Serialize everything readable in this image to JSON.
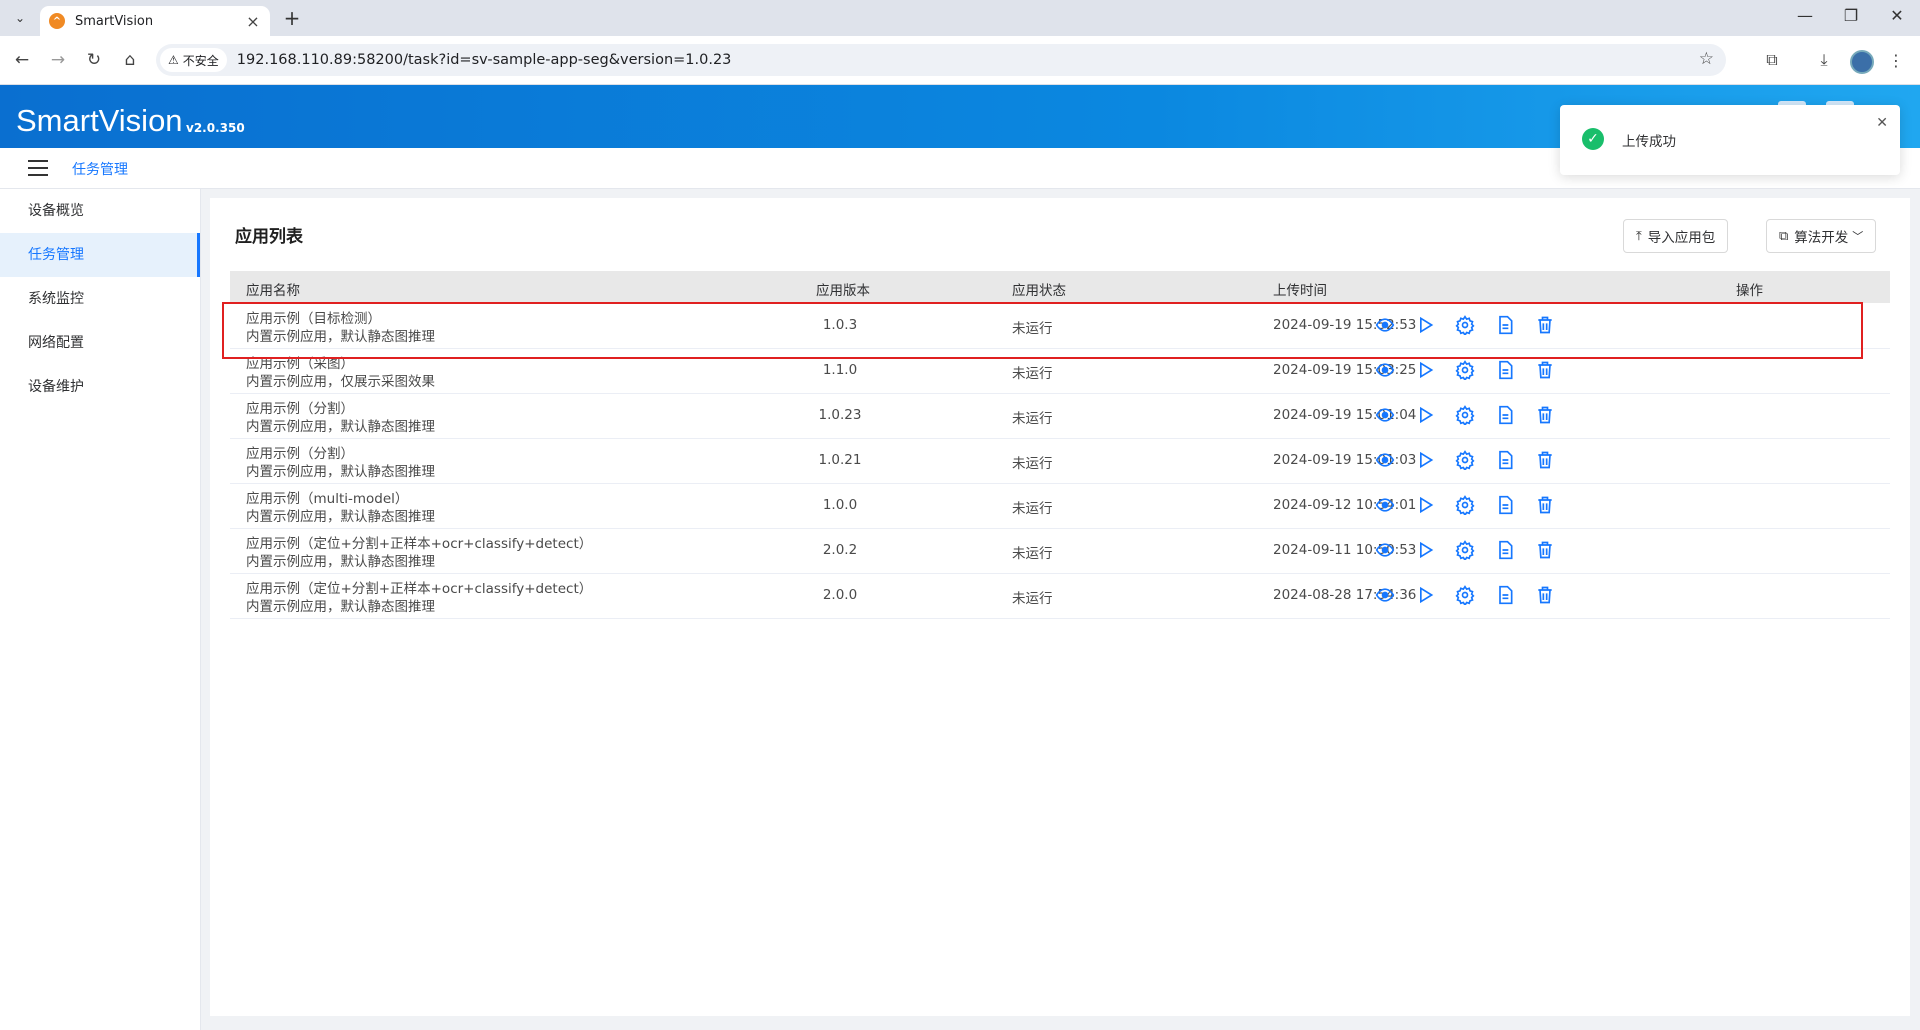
{
  "browser": {
    "tab_title": "SmartVision",
    "security_label": "不安全",
    "url": "192.168.110.89:58200/task?id=sv-sample-app-seg&version=1.0.23"
  },
  "header": {
    "brand": "SmartVision",
    "version": "v2.0.350"
  },
  "breadcrumb": {
    "current": "任务管理"
  },
  "sidebar": {
    "items": [
      {
        "label": "设备概览"
      },
      {
        "label": "任务管理",
        "active": true
      },
      {
        "label": "系统监控"
      },
      {
        "label": "网络配置"
      },
      {
        "label": "设备维护"
      }
    ]
  },
  "panel": {
    "title": "应用列表",
    "import_label": "导入应用包",
    "dev_label": "算法开发"
  },
  "table": {
    "headers": {
      "name": "应用名称",
      "version": "应用版本",
      "status": "应用状态",
      "time": "上传时间",
      "ops": "操作"
    },
    "rows": [
      {
        "name": "应用示例（目标检测）",
        "desc": "内置示例应用，默认静态图推理",
        "version": "1.0.3",
        "status": "未运行",
        "time": "2024-09-19 15:52:53"
      },
      {
        "name": "应用示例（采图）",
        "desc": "内置示例应用，仅展示采图效果",
        "version": "1.1.0",
        "status": "未运行",
        "time": "2024-09-19 15:03:25"
      },
      {
        "name": "应用示例（分割）",
        "desc": "内置示例应用，默认静态图推理",
        "version": "1.0.23",
        "status": "未运行",
        "time": "2024-09-19 15:01:04"
      },
      {
        "name": "应用示例（分割）",
        "desc": "内置示例应用，默认静态图推理",
        "version": "1.0.21",
        "status": "未运行",
        "time": "2024-09-19 15:01:03"
      },
      {
        "name": "应用示例（multi-model）",
        "desc": "内置示例应用，默认静态图推理",
        "version": "1.0.0",
        "status": "未运行",
        "time": "2024-09-12 10:54:01"
      },
      {
        "name": "应用示例（定位+分割+正样本+ocr+classify+detect）",
        "desc": "内置示例应用，默认静态图推理",
        "version": "2.0.2",
        "status": "未运行",
        "time": "2024-09-11 10:50:53"
      },
      {
        "name": "应用示例（定位+分割+正样本+ocr+classify+detect）",
        "desc": "内置示例应用，默认静态图推理",
        "version": "2.0.0",
        "status": "未运行",
        "time": "2024-08-28 17:54:36"
      }
    ]
  },
  "toast": {
    "message": "上传成功"
  },
  "colors": {
    "primary": "#1677ff",
    "header_gradient_start": "#0a6fd0",
    "highlight": "#e02020",
    "success": "#19be6b"
  }
}
